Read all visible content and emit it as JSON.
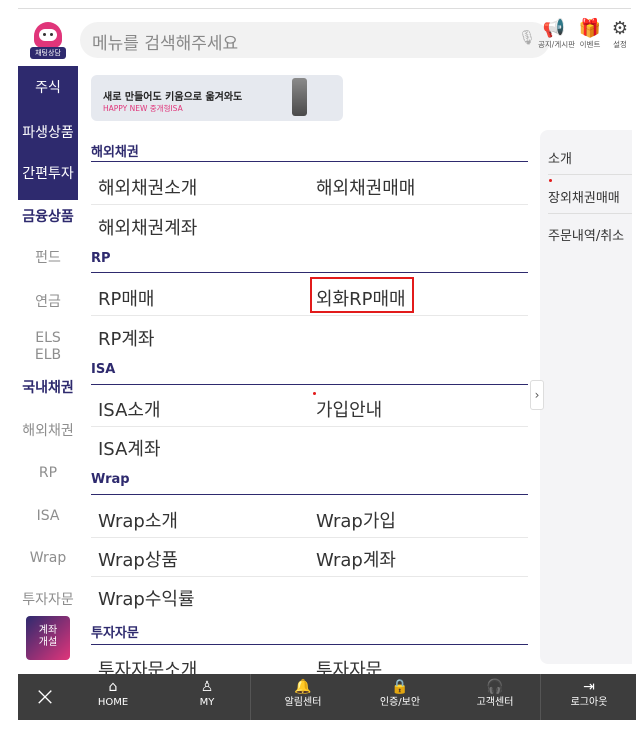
{
  "header": {
    "chatbot_label": "채팅상담",
    "search_placeholder": "메뉴를 검색해주세요",
    "icons": [
      {
        "name": "megaphone-icon",
        "glyph": "📢",
        "label": "공지/게시판"
      },
      {
        "name": "gift-icon",
        "glyph": "🎁",
        "label": "이벤트"
      },
      {
        "name": "gear-icon",
        "glyph": "⚙",
        "label": "설정"
      }
    ]
  },
  "sidebar": {
    "items": [
      "주식",
      "파생상품",
      "간편투자",
      "금융상품",
      "펀드",
      "연금",
      "ELS\nELB",
      "국내채권",
      "해외채권",
      "RP",
      "ISA",
      "Wrap",
      "투자자문"
    ],
    "active": "금융상품",
    "open_account": "계좌\n개설"
  },
  "banner": {
    "title": "새로 만들어도 키움으로 옮겨와도",
    "subtitle": "HAPPY NEW 중개형ISA"
  },
  "sections": [
    {
      "title": "해외채권",
      "items": [
        "해외채권소개",
        "해외채권매매",
        "해외채권계좌"
      ]
    },
    {
      "title": "RP",
      "items": [
        "RP매매",
        "외화RP매매",
        "RP계좌"
      ]
    },
    {
      "title": "ISA",
      "items": [
        "ISA소개",
        "가입안내",
        "ISA계좌"
      ]
    },
    {
      "title": "Wrap",
      "items": [
        "Wrap소개",
        "Wrap가입",
        "Wrap상품",
        "Wrap계좌",
        "Wrap수익률"
      ]
    },
    {
      "title": "투자자문",
      "items": [
        "투자자문소개",
        "투자자문"
      ]
    }
  ],
  "highlighted_item": "외화RP매매",
  "right_panel": {
    "items": [
      "소개",
      "장외채권매매",
      "주문내역/취소"
    ],
    "toggle": "›"
  },
  "bottom_bar": {
    "close": "×",
    "items": [
      {
        "icon": "home-icon",
        "glyph": "⌂",
        "label": "HOME"
      },
      {
        "icon": "person-icon",
        "glyph": "♙",
        "label": "MY"
      },
      {
        "icon": "bell-icon",
        "glyph": "🔔",
        "label": "알림센터"
      },
      {
        "icon": "lock-icon",
        "glyph": "🔒",
        "label": "인증/보안"
      },
      {
        "icon": "headset-icon",
        "glyph": "🎧",
        "label": "고객센터"
      },
      {
        "icon": "logout-icon",
        "glyph": "⇥",
        "label": "로그아웃"
      }
    ]
  },
  "colors": {
    "brand_navy": "#2e2a6e",
    "brand_pink": "#e0357a",
    "highlight_red": "#e21b1b"
  }
}
